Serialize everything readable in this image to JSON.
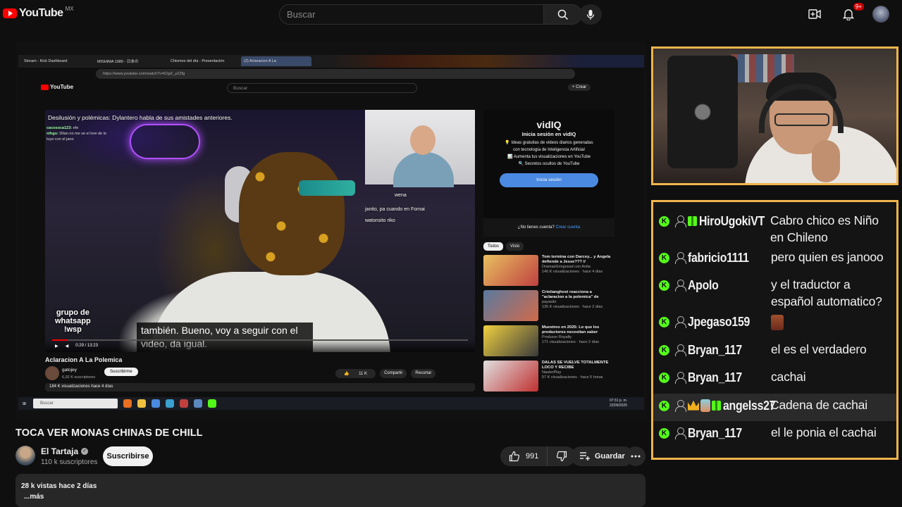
{
  "header": {
    "logo_text": "YouTube",
    "country": "MX",
    "search_placeholder": "Buscar",
    "notif_badge": "9+"
  },
  "inner_browser": {
    "tabs": [
      "Stream - Kick Dashboard",
      "MISHIMA 1980 - 日本の",
      "Chismes del día - Presentación",
      "(2) Aclaracion A La"
    ],
    "url": "https://www.youtube.com/watch?v=lClgX_yZZfg",
    "yt_logo": "YouTube",
    "yt_country": "MX",
    "search_placeholder": "Buscar",
    "create_label": "+ Crear",
    "video": {
      "overlay_title": "Desilusión y polémicas: Dylantero habla de sus amistades anteriores.",
      "mini_chat": [
        {
          "user": "cacosoca123:",
          "text": "efe"
        },
        {
          "user": "nihgo:",
          "text": "Dilan no me se el lore de lo"
        },
        {
          "user": "",
          "text": "tuyo con el jano"
        }
      ],
      "stream_chat": [
        "wena",
        "janito, pa cuando    en Fornai",
        "watonsito riko"
      ],
      "grupo_text": [
        "grupo de",
        "whatsapp",
        "!wsp"
      ],
      "subtitle": "también. Bueno, voy a seguir con el video, da igual.",
      "time": "0:29 / 13:23",
      "progress": 0.037
    },
    "title": "Aclaracion A La Polemica",
    "channel": "gatojey",
    "subs": "6,92 K suscriptores",
    "subscribe_label": "Suscribirme",
    "likes": "11 K",
    "share_label": "Compartir",
    "clip_label": "Recortar",
    "views": "184 K visualizaciones  hace 4 días",
    "vidiq": {
      "brand": "vidIQ",
      "title": "Inicia sesión en vidIQ",
      "lines": [
        "💡 Ideas gratuitas de videos diarios generadas",
        "con tecnología de Inteligencia Artificial",
        "📊 Aumenta tus visualizaciones en YouTube",
        "🔍 Secretos ocultos de YouTube"
      ],
      "button": "Inicia sesión",
      "footer_q": "¿No tienes cuenta?",
      "footer_link": "Crear cuenta"
    },
    "chips": [
      "Todos",
      "Visto"
    ],
    "recs": [
      {
        "title": "Tom termina con Darcey... y Angela defiende a Jesse??? //",
        "channel": "DramasGringosad con Anita",
        "meta": "140 K visualizaciones · hace 4 días",
        "badge": "Nuevo",
        "dur": "46:36"
      },
      {
        "title": "Cristianghost reacciona a \"aclaracion a la polemica\" de",
        "channel": "payasito",
        "meta": "135 K visualizaciones · hace 2 días",
        "badge": "Nuevo",
        "dur": "1:07:36"
      },
      {
        "title": "Muestreo en 2025: Lo que los productores necesitan saber",
        "channel": "Producer Royalty",
        "meta": "171 visualizaciones · hace 2 días",
        "badge": "Nuevo",
        "dur": "12:16"
      },
      {
        "title": "DALAS SE VUELVE TOTALMENTE LOCO Y RECIBE",
        "channel": "NauterPlay",
        "meta": "57 K visualizaciones · hace 5 horas",
        "badge": "",
        "dur": "16:49"
      }
    ],
    "taskbar": {
      "search": "Buscar",
      "time": "07:31 p. m.",
      "date": "22/09/2025"
    }
  },
  "video": {
    "title": "TOCA VER MONAS CHINAS DE CHILL",
    "channel": "El Tartaja",
    "subs": "110 k suscriptores",
    "subscribe_label": "Suscribirse",
    "likes": "991",
    "save_label": "Guardar",
    "views_line": "28 k vistas  hace 2 días",
    "more_label": "...más"
  },
  "chat": {
    "partial_top": "",
    "messages": [
      {
        "user": "HiroUgokiVT",
        "badges": [
          "gift"
        ],
        "text": "Cabro chico es Niño en Chileno"
      },
      {
        "user": "fabricio1111",
        "badges": [],
        "text": "pero quien es janooo"
      },
      {
        "user": "Apolo",
        "badges": [],
        "text": "y el traductor a español automatico?"
      },
      {
        "user": "Jpegaso159",
        "badges": [],
        "text": "",
        "emote": true
      },
      {
        "user": "Bryan_117",
        "badges": [],
        "text": "el es el verdadero"
      },
      {
        "user": "Bryan_117",
        "badges": [],
        "text": "cachai"
      },
      {
        "user": "angelss27",
        "badges": [
          "crown",
          "pot",
          "gift"
        ],
        "text": "Cadena de cachai",
        "highlight": true
      },
      {
        "user": "Bryan_117",
        "badges": [],
        "text": "el le ponia el cachai"
      }
    ]
  },
  "colors": {
    "accent": "#f0b44c",
    "kick_green": "#53fc18",
    "yt_red": "#ff0000"
  }
}
